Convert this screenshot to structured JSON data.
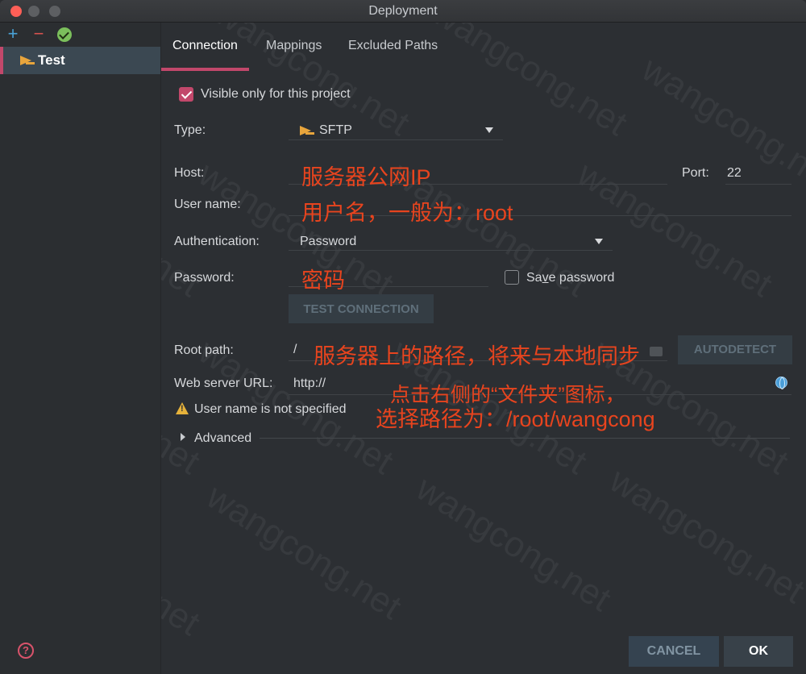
{
  "window": {
    "title": "Deployment"
  },
  "sidebar": {
    "toolbar": {
      "add": "+",
      "remove": "−"
    },
    "items": [
      {
        "label": "Test",
        "icon": "sftp-icon",
        "selected": true
      }
    ],
    "help": "?"
  },
  "tabs": [
    {
      "label": "Connection",
      "active": true
    },
    {
      "label": "Mappings",
      "active": false
    },
    {
      "label": "Excluded Paths",
      "active": false
    }
  ],
  "form": {
    "visible_only": {
      "label": "Visible only for this project",
      "checked": true
    },
    "type": {
      "label": "Type:",
      "value": "SFTP"
    },
    "host": {
      "label": "Host:",
      "value": ""
    },
    "port": {
      "label": "Port:",
      "value": "22"
    },
    "username": {
      "label": "User name:",
      "value": ""
    },
    "authentication": {
      "label": "Authentication:",
      "value": "Password"
    },
    "password": {
      "label": "Password:",
      "value": ""
    },
    "save_password": {
      "label_pre": "Sa",
      "label_u": "v",
      "label_post": "e password",
      "checked": false
    },
    "test_connection": "TEST CONNECTION",
    "root_path": {
      "label": "Root path:",
      "value": "/"
    },
    "autodetect": "AUTODETECT",
    "web_server_url": {
      "label": "Web server URL:",
      "value": "http://"
    },
    "warning": "User name is not specified",
    "advanced": "Advanced"
  },
  "annotations": {
    "host": "服务器公网IP",
    "username": "用户名，一般为：root",
    "password": "密码",
    "root_path": "服务器上的路径，将来与本地同步",
    "web_url_line1": "点击右侧的“文件夹”图标，",
    "web_url_line2": "选择路径为：/root/wangcong"
  },
  "footer": {
    "cancel": "CANCEL",
    "ok": "OK"
  },
  "watermark": "wangcong.net",
  "colors": {
    "accent": "#c2486b",
    "annotation": "#e8441e",
    "background": "#2c2f33"
  }
}
